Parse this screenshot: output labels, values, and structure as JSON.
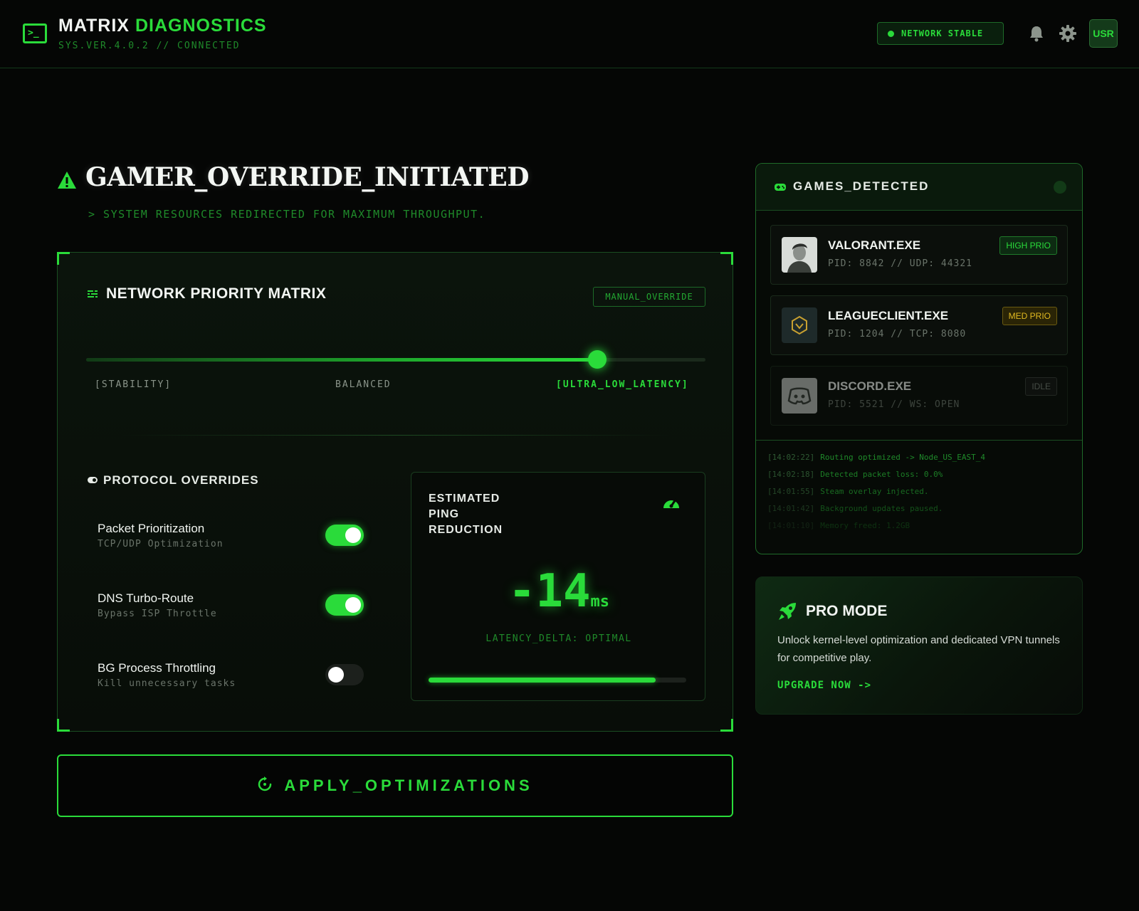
{
  "header": {
    "title_main": "MATRIX",
    "title_accent": "DIAGNOSTICS",
    "subtitle": "SYS.VER.4.0.2 // CONNECTED",
    "network_status": "NETWORK STABLE",
    "user_label": "USR",
    "icons": [
      "terminal-icon",
      "bell-icon",
      "gear-icon"
    ]
  },
  "hero": {
    "title": "GAMER_OVERRIDE_INITIATED",
    "subtitle": "> SYSTEM RESOURCES REDIRECTED FOR MAXIMUM THROUGHPUT."
  },
  "priority_matrix": {
    "title": "NETWORK PRIORITY MATRIX",
    "mode_tag": "MANUAL_OVERRIDE",
    "slider_value_fraction": 0.825,
    "labels": {
      "left": "[STABILITY]",
      "middle": "BALANCED",
      "right": "[ULTRA_LOW_LATENCY]"
    }
  },
  "protocol_overrides": {
    "title": "PROTOCOL OVERRIDES",
    "items": [
      {
        "name": "Packet Prioritization",
        "description": "TCP/UDP Optimization",
        "enabled": true
      },
      {
        "name": "DNS Turbo-Route",
        "description": "Bypass ISP Throttle",
        "enabled": true
      },
      {
        "name": "BG Process Throttling",
        "description": "Kill unnecessary tasks",
        "enabled": false
      }
    ]
  },
  "ping": {
    "title_line1": "ESTIMATED",
    "title_line2": "PING",
    "title_line3": "REDUCTION",
    "value": "-14",
    "unit": "ms",
    "delta_label": "LATENCY_DELTA: OPTIMAL",
    "progress_fraction": 0.88
  },
  "apply_button": {
    "label": "APPLY_OPTIMIZATIONS"
  },
  "games": {
    "title": "GAMES_DETECTED",
    "items": [
      {
        "name": "VALORANT.EXE",
        "meta": "PID: 8842 // UDP: 44321",
        "priority": "HIGH PRIO",
        "level": "high"
      },
      {
        "name": "LEAGUECLIENT.EXE",
        "meta": "PID: 1204 // TCP: 8080",
        "priority": "MED PRIO",
        "level": "med"
      },
      {
        "name": "DISCORD.EXE",
        "meta": "PID: 5521 // WS: OPEN",
        "priority": "IDLE",
        "level": "idle"
      }
    ],
    "log": [
      {
        "time": "[14:02:22]",
        "message": "Routing optimized -> Node_US_EAST_4"
      },
      {
        "time": "[14:02:18]",
        "message": "Detected packet loss: 0.0%"
      },
      {
        "time": "[14:01:55]",
        "message": "Steam overlay injected."
      },
      {
        "time": "[14:01:42]",
        "message": "Background updates paused."
      },
      {
        "time": "[14:01:10]",
        "message": "Memory freed: 1.2GB"
      }
    ]
  },
  "pro_mode": {
    "title": "PRO MODE",
    "description": "Unlock kernel-level optimization and dedicated VPN tunnels for competitive play.",
    "link": "UPGRADE NOW ->"
  },
  "colors": {
    "accent": "#2adb3a",
    "background": "#050605",
    "medium_priority": "#e0b820"
  }
}
